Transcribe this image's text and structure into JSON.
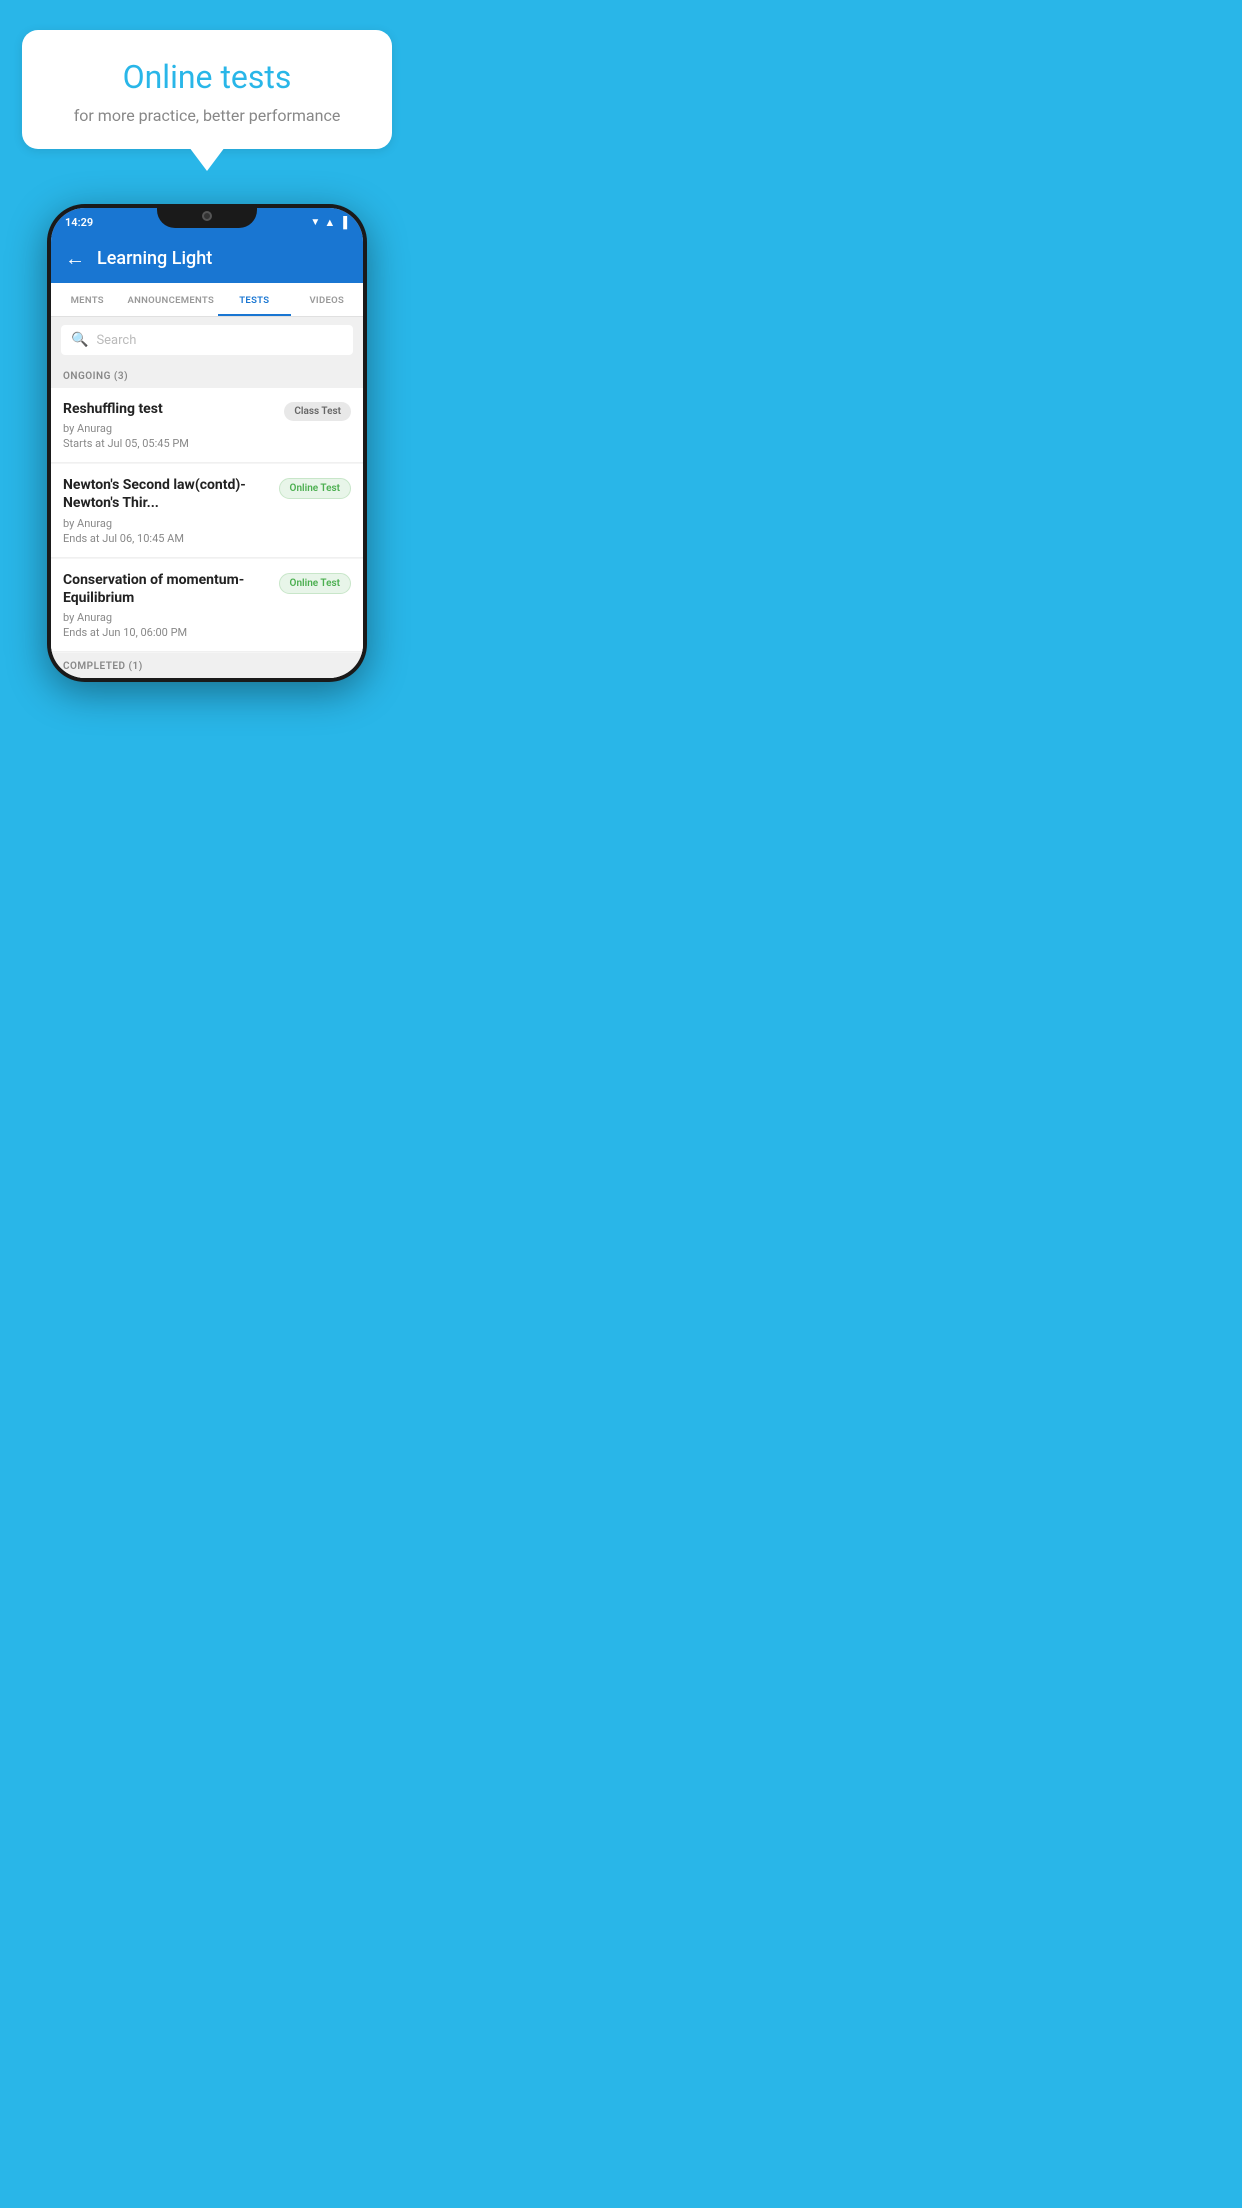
{
  "background_color": "#29b6e8",
  "speech_bubble": {
    "title": "Online tests",
    "subtitle": "for more practice, better performance"
  },
  "status_bar": {
    "time": "14:29",
    "icons": [
      "wifi",
      "signal",
      "battery"
    ]
  },
  "app_header": {
    "back_label": "←",
    "title": "Learning Light"
  },
  "tabs": [
    {
      "label": "MENTS",
      "active": false
    },
    {
      "label": "ANNOUNCEMENTS",
      "active": false
    },
    {
      "label": "TESTS",
      "active": true
    },
    {
      "label": "VIDEOS",
      "active": false
    }
  ],
  "search": {
    "placeholder": "Search"
  },
  "ongoing_section": {
    "header": "ONGOING (3)",
    "tests": [
      {
        "title": "Reshuffling test",
        "author": "by Anurag",
        "time_label": "Starts at",
        "time_value": "Jul 05, 05:45 PM",
        "badge": "Class Test",
        "badge_type": "class"
      },
      {
        "title": "Newton's Second law(contd)-Newton's Thir...",
        "author": "by Anurag",
        "time_label": "Ends at",
        "time_value": "Jul 06, 10:45 AM",
        "badge": "Online Test",
        "badge_type": "online"
      },
      {
        "title": "Conservation of momentum-Equilibrium",
        "author": "by Anurag",
        "time_label": "Ends at",
        "time_value": "Jun 10, 06:00 PM",
        "badge": "Online Test",
        "badge_type": "online"
      }
    ]
  },
  "completed_section": {
    "header": "COMPLETED (1)"
  }
}
